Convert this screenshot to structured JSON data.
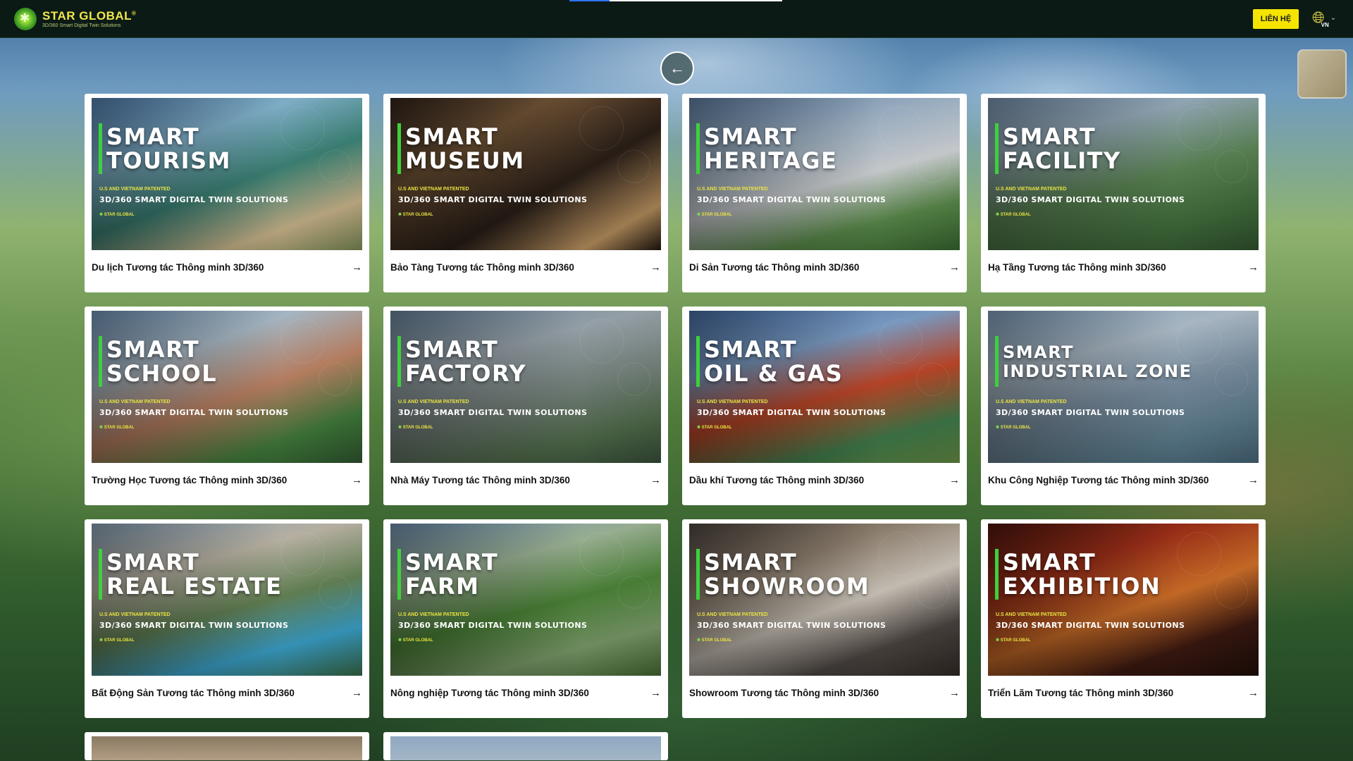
{
  "brand": {
    "name": "STAR GLOBAL",
    "reg": "®",
    "tagline": "3D/360 Smart Digital Twin Solutions"
  },
  "header": {
    "contact_label": "LIÊN HỆ",
    "language_code": "VN",
    "progress_fraction": 0.19
  },
  "icons": {
    "back": "arrow-left-icon",
    "language": "globe-icon",
    "caret": "chevron-down-icon",
    "card_arrow": "arrow-right-icon"
  },
  "card_common": {
    "patent": "U.S AND VIETNAM PATENTED",
    "solutions": "3D/360 SMART DIGITAL TWIN SOLUTIONS",
    "mini_brand": "STAR GLOBAL"
  },
  "cards": [
    {
      "line1": "SMART",
      "line2": "TOURISM",
      "caption": "Du lịch Tương tác Thông minh 3D/360",
      "bg": "linear-gradient(160deg,#5d8fc6 0%,#8cc0dc 30%,#3f8a7c 55%,#c9b48a 80%,#6b7a4a 100%)"
    },
    {
      "line1": "SMART",
      "line2": "MUSEUM",
      "caption": "Bảo Tàng Tương tác Thông minh 3D/360",
      "bg": "linear-gradient(150deg,#3a2a20 0%,#7a5a3a 30%,#2a1f18 60%,#b08a5a 85%,#1a120c 100%)"
    },
    {
      "line1": "SMART",
      "line2": "HERITAGE",
      "caption": "Di Sản Tương tác Thông minh 3D/360",
      "bg": "linear-gradient(165deg,#6c8fb8 0%,#a9bfd4 30%,#d9dde0 55%,#5a8a4a 78%,#2f5a2a 100%)"
    },
    {
      "line1": "SMART",
      "line2": "FACILITY",
      "caption": "Hạ Tầng Tương tác Thông minh 3D/360",
      "bg": "linear-gradient(165deg,#8aa8c8 0%,#9fb6c6 25%,#5f8a58 55%,#3f6a3a 80%,#2a4a28 100%)"
    },
    {
      "line1": "SMART",
      "line2": "SCHOOL",
      "caption": "Trường Học Tương tác Thông minh 3D/360",
      "bg": "linear-gradient(160deg,#7fa7cf 0%,#b7c9d6 30%,#c88a6a 55%,#3f7a3a 80%,#2a4a2a 100%)"
    },
    {
      "line1": "SMART",
      "line2": "FACTORY",
      "caption": "Nhà Máy Tương tác Thông minh 3D/360",
      "bg": "linear-gradient(165deg,#7896b2 0%,#a4b0b8 30%,#7d8a84 55%,#4f6a4a 80%,#2f4430 100%)"
    },
    {
      "line1": "SMART",
      "line2": "OIL & GAS",
      "caption": "Dầu khí Tương tác Thông minh 3D/360",
      "bg": "linear-gradient(165deg,#4f7bb8 0%,#86a9d4 30%,#c84a2a 55%,#3f7a4a 80%,#5a7a3a 100%)"
    },
    {
      "line1": "SMART",
      "line2": "INDUSTRIAL ZONE",
      "caption": "Khu Công Nghiệp Tương tác Thông minh 3D/360",
      "bg": "linear-gradient(165deg,#8fb2d4 0%,#b9c9d6 30%,#7f95a8 55%,#5a7a8a 80%,#3f5a6a 100%)",
      "small": true
    },
    {
      "line1": "SMART",
      "line2": "REAL ESTATE",
      "caption": "Bất Động Sản Tương tác Thông minh 3D/360",
      "bg": "linear-gradient(165deg,#9ab7cf 0%,#c9c2b2 30%,#6a8a5a 55%,#3aa0c8 78%,#2f5a3a 100%)"
    },
    {
      "line1": "SMART",
      "line2": "FARM",
      "caption": "Nông nghiệp Tương tác Thông minh 3D/360",
      "bg": "linear-gradient(165deg,#7fa3c8 0%,#a8c0a0 30%,#4f8a3a 55%,#7a9a6a 78%,#3a5a2a 100%)"
    },
    {
      "line1": "SMART",
      "line2": "SHOWROOM",
      "caption": "Showroom Tương tác Thông minh 3D/360",
      "bg": "linear-gradient(160deg,#5a5048 0%,#9a8a78 30%,#d8d0c4 55%,#4a4440 78%,#2a2420 100%)"
    },
    {
      "line1": "SMART",
      "line2": "EXHIBITION",
      "caption": "Triển Lãm Tương tác Thông minh 3D/360",
      "bg": "linear-gradient(160deg,#5a1a10 0%,#a8321a 30%,#d8742a 55%,#3a1810 78%,#1a0c08 100%)"
    }
  ],
  "partial_cards": [
    {
      "bg": "linear-gradient(180deg,#8a7a62,#b8a48a)"
    },
    {
      "bg": "linear-gradient(180deg,#8fa9c2,#a6b8c6)"
    }
  ]
}
